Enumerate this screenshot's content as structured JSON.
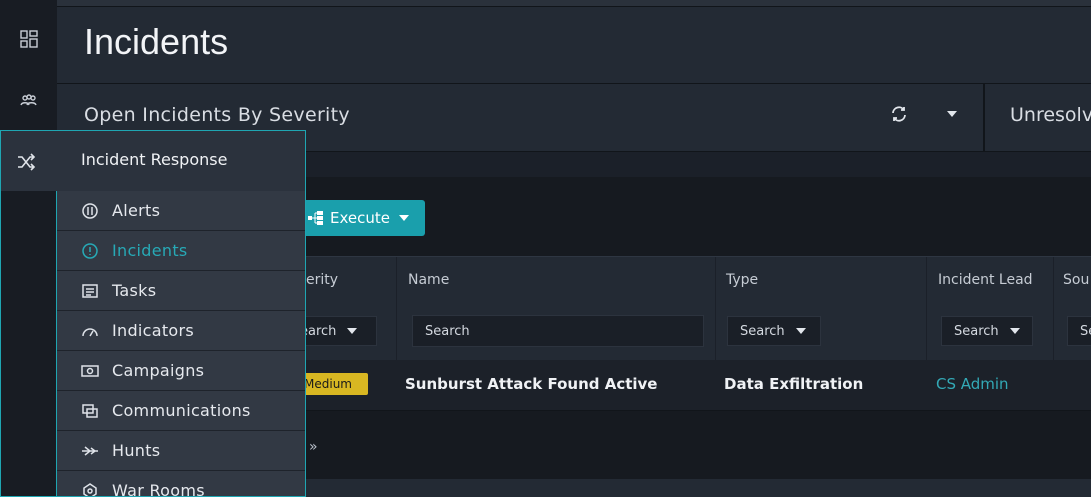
{
  "app": {
    "page_title": "Incidents",
    "accent_color": "#1a9fac",
    "rail_icons": [
      "dashboard-icon",
      "users-icon",
      "shuffle-icon",
      "bolt-icon",
      "briefcase-icon",
      "analytics-icon",
      "widgets-icon",
      "hexagon-icon"
    ]
  },
  "widgets": {
    "first_title": "Open Incidents By Severity",
    "second_title": "Unresolv"
  },
  "toolbar": {
    "execute_label": "Execute"
  },
  "grid": {
    "columns": [
      {
        "label": "erity",
        "filter": "earch"
      },
      {
        "label": "Name",
        "filter": "Search"
      },
      {
        "label": "Type",
        "filter": "Search"
      },
      {
        "label": "Incident Lead",
        "filter": "Search"
      },
      {
        "label": "Sou",
        "filter": "Se"
      }
    ],
    "rows": [
      {
        "severity": "Medium",
        "severity_color": "#d8b722",
        "name": "Sunburst Attack Found Active",
        "type": "Data Exfiltration",
        "incident_lead": "CS Admin"
      }
    ],
    "pager_next": "»"
  },
  "flyout": {
    "title": "Incident Response",
    "items": [
      {
        "label": "Alerts",
        "icon": "alert-octagon-icon",
        "active": false
      },
      {
        "label": "Incidents",
        "icon": "incident-icon",
        "active": true
      },
      {
        "label": "Tasks",
        "icon": "tasks-icon",
        "active": false
      },
      {
        "label": "Indicators",
        "icon": "gauge-icon",
        "active": false
      },
      {
        "label": "Campaigns",
        "icon": "campaign-icon",
        "active": false
      },
      {
        "label": "Communications",
        "icon": "communications-icon",
        "active": false
      },
      {
        "label": "Hunts",
        "icon": "hunt-icon",
        "active": false
      },
      {
        "label": "War Rooms",
        "icon": "war-room-icon",
        "active": false
      }
    ]
  }
}
